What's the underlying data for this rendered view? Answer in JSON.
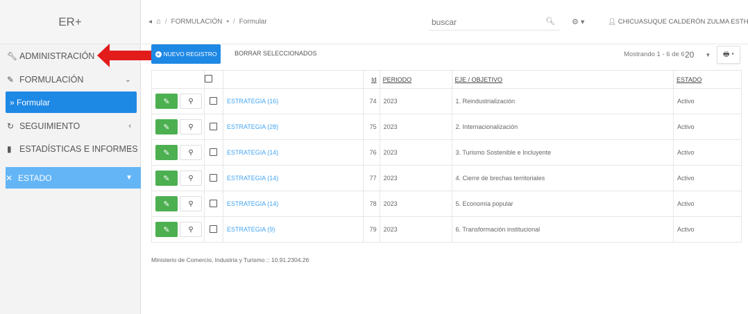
{
  "sidebar": {
    "brand": "ER+",
    "items": [
      {
        "label": "ADMINISTRACIÓN",
        "icon": "wrench-icon"
      },
      {
        "label": "FORMULACIÓN",
        "icon": "edit-icon"
      },
      {
        "label": "» Formular"
      },
      {
        "label": "SEGUIMIENTO",
        "icon": "refresh-icon"
      },
      {
        "label": "ESTADÍSTICAS E INFORMES",
        "icon": "bar-chart-icon"
      },
      {
        "label": "ESTADO",
        "icon": "close-icon"
      }
    ]
  },
  "header": {
    "breadcrumb": [
      "FORMULACIÓN",
      "Formular"
    ],
    "search_placeholder": "buscar",
    "user": "CHICUASUQUE CALDERÓN ZULMA ESTHER"
  },
  "toolbar": {
    "new_label": "NUEVO REGISTRO",
    "delete_label": "BORRAR SELECCIONADOS",
    "showing": "Mostrando 1 - 6 de 6",
    "page_size": "20"
  },
  "table": {
    "columns": [
      "Id",
      "PERIODO",
      "EJE / OBJETIVO",
      "ESTADO"
    ],
    "rows": [
      {
        "name": "ESTRATEGIA (16)",
        "id": "74",
        "periodo": "2023",
        "eje": "1. Reindustrialización",
        "estado": "Activo"
      },
      {
        "name": "ESTRATEGIA (28)",
        "id": "75",
        "periodo": "2023",
        "eje": "2. Internacionalización",
        "estado": "Activo"
      },
      {
        "name": "ESTRATEGIA (14)",
        "id": "76",
        "periodo": "2023",
        "eje": "3. Turismo Sostenible e Incluyente",
        "estado": "Activo"
      },
      {
        "name": "ESTRATEGIA (14)",
        "id": "77",
        "periodo": "2023",
        "eje": "4. Cierre de brechas territoriales",
        "estado": "Activo"
      },
      {
        "name": "ESTRATEGIA (14)",
        "id": "78",
        "periodo": "2023",
        "eje": "5. Economía popular",
        "estado": "Activo"
      },
      {
        "name": "ESTRATEGIA (9)",
        "id": "79",
        "periodo": "2023",
        "eje": "6. Transformación institucional",
        "estado": "Activo"
      }
    ]
  },
  "footer": "Ministerio de Comercio, Industria y Turismo :: 10.91.2304.26",
  "colors": {
    "primary": "#1e88e5",
    "estado_bar": "#64b5f6",
    "edit_green": "#4caf50",
    "arrow_red": "#e21b1b",
    "link": "#42a5f5"
  }
}
